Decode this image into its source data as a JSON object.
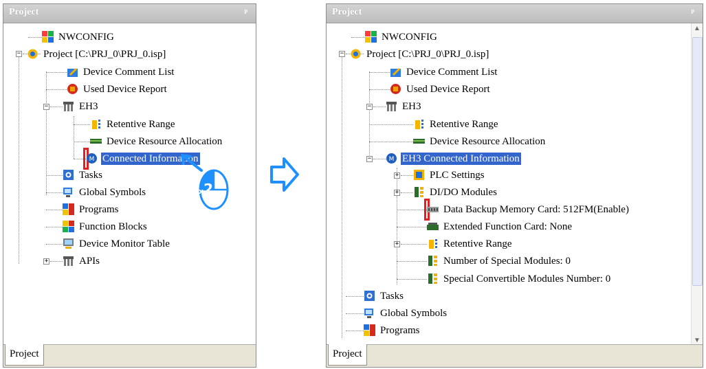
{
  "colors": {
    "selection": "#3366cc",
    "highlight_box": "#e02020",
    "accent_blue": "#1e90ff"
  },
  "left_panel": {
    "title": "Project",
    "pin_icon": "pin-icon",
    "tab_label": "Project",
    "double_click_badge": {
      "prefix": "x",
      "count": "2"
    },
    "nodes": [
      {
        "label": "NWCONFIG",
        "icon": "nwconfig-icon"
      },
      {
        "label": "Project [C:\\PRJ_0\\PRJ_0.isp]",
        "icon": "project-icon"
      },
      {
        "label": "Device Comment List",
        "icon": "comment-list-icon"
      },
      {
        "label": "Used Device Report",
        "icon": "device-report-icon"
      },
      {
        "label": "EH3",
        "icon": "plc-icon"
      },
      {
        "label": "Retentive Range",
        "icon": "retentive-range-icon"
      },
      {
        "label": "Device Resource Allocation",
        "icon": "resource-allocation-icon"
      },
      {
        "label": "Connected Information",
        "icon": "connected-info-icon"
      },
      {
        "label": "Tasks",
        "icon": "tasks-icon"
      },
      {
        "label": "Global Symbols",
        "icon": "global-symbols-icon"
      },
      {
        "label": "Programs",
        "icon": "programs-icon"
      },
      {
        "label": "Function Blocks",
        "icon": "function-blocks-icon"
      },
      {
        "label": "Device Monitor Table",
        "icon": "monitor-table-icon"
      },
      {
        "label": "APIs",
        "icon": "apis-icon"
      }
    ]
  },
  "right_panel": {
    "title": "Project",
    "pin_icon": "pin-icon",
    "tab_label": "Project",
    "nodes": [
      {
        "label": "NWCONFIG",
        "icon": "nwconfig-icon"
      },
      {
        "label": "Project [C:\\PRJ_0\\PRJ_0.isp]",
        "icon": "project-icon"
      },
      {
        "label": "Device Comment List",
        "icon": "comment-list-icon"
      },
      {
        "label": "Used Device Report",
        "icon": "device-report-icon"
      },
      {
        "label": "EH3",
        "icon": "plc-icon"
      },
      {
        "label": "Retentive Range",
        "icon": "retentive-range-icon"
      },
      {
        "label": "Device Resource Allocation",
        "icon": "resource-allocation-icon"
      },
      {
        "label": "EH3 Connected Information",
        "icon": "connected-info-icon"
      },
      {
        "label": "PLC Settings",
        "icon": "plc-settings-icon"
      },
      {
        "label": "DI/DO Modules",
        "icon": "dido-modules-icon"
      },
      {
        "label": "Data Backup Memory Card: 512FM(Enable)",
        "icon": "memory-card-icon"
      },
      {
        "label": "Extended Function Card: None",
        "icon": "function-card-icon"
      },
      {
        "label": "Retentive Range",
        "icon": "retentive-range-icon"
      },
      {
        "label": "Number of Special Modules: 0",
        "icon": "special-modules-icon"
      },
      {
        "label": "Special Convertible Modules Number: 0",
        "icon": "convertible-modules-icon"
      },
      {
        "label": "Tasks",
        "icon": "tasks-icon"
      },
      {
        "label": "Global Symbols",
        "icon": "global-symbols-icon"
      },
      {
        "label": "Programs",
        "icon": "programs-icon"
      }
    ]
  },
  "transition_arrow_icon": "arrow-right-icon"
}
